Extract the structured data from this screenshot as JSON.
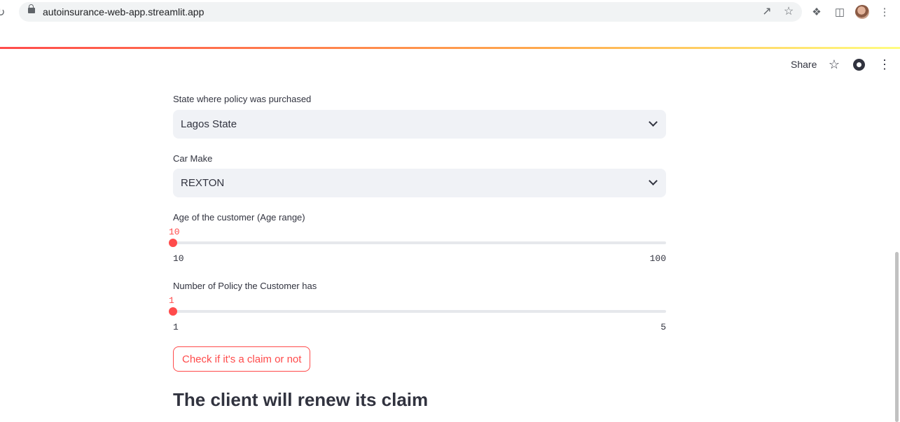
{
  "browser": {
    "url": "autoinsurance-web-app.streamlit.app",
    "icons": [
      "reload-icon",
      "lock-icon",
      "share-page-icon",
      "bookmark-star-icon",
      "extensions-icon",
      "side-panel-icon",
      "profile-avatar",
      "menu-icon"
    ]
  },
  "app_toolbar": {
    "share_label": "Share"
  },
  "form": {
    "state": {
      "label": "State where policy was purchased",
      "value": "Lagos State"
    },
    "car_make": {
      "label": "Car Make",
      "value": "REXTON"
    },
    "age": {
      "label": "Age of the customer (Age range)",
      "value": "10",
      "min": "10",
      "max": "100",
      "fraction": 0
    },
    "policies": {
      "label": "Number of Policy the Customer has",
      "value": "1",
      "min": "1",
      "max": "5",
      "fraction": 0
    },
    "submit_label": "Check if it's a claim or not"
  },
  "result": {
    "text": "The client will renew its claim"
  },
  "colors": {
    "accent": "#ff4b4b",
    "text": "#31333f",
    "input_bg": "#f0f2f6"
  }
}
